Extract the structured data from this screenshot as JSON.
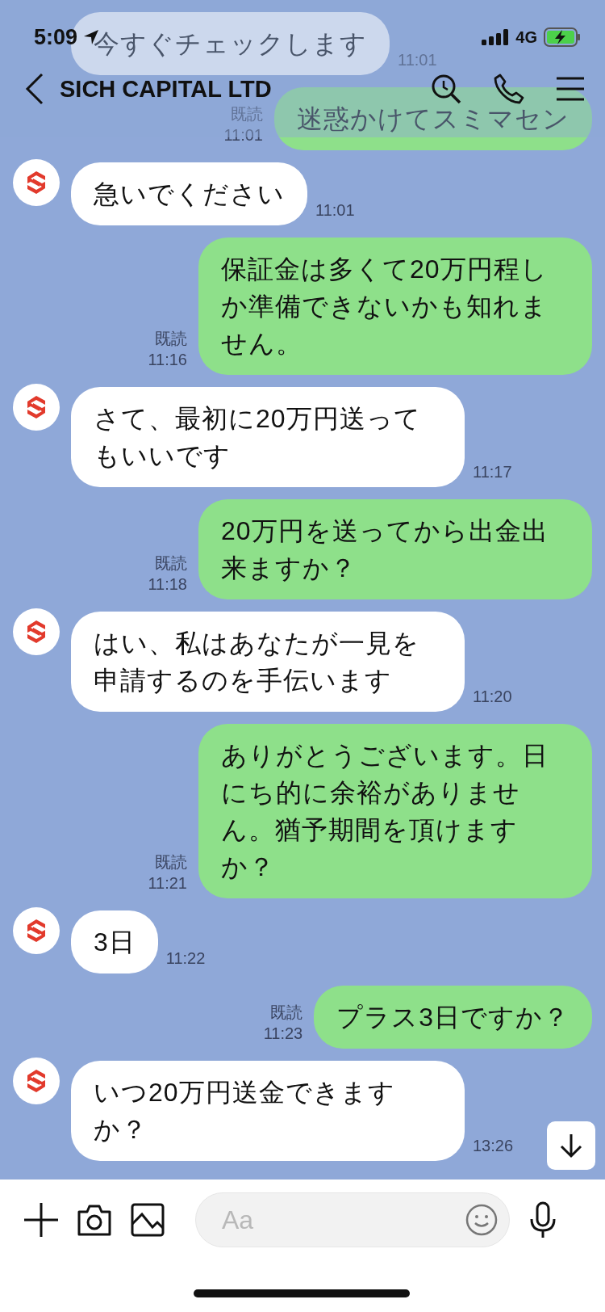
{
  "status_bar": {
    "time": "5:09",
    "network": "4G"
  },
  "header": {
    "title": "SICH CAPITAL LTD"
  },
  "messages": [
    {
      "kind": "incoming",
      "avatar": false,
      "text": "今すぐチェックします",
      "time": "11:01"
    },
    {
      "kind": "outgoing",
      "read_label": "既読",
      "text": "迷惑かけてスミマセン",
      "time": "11:01"
    },
    {
      "kind": "incoming",
      "avatar": true,
      "text": "急いでください",
      "time": "11:01"
    },
    {
      "kind": "outgoing",
      "read_label": "既読",
      "text": "保証金は多くて20万円程しか準備できないかも知れません。",
      "time": "11:16"
    },
    {
      "kind": "incoming",
      "avatar": true,
      "text": "さて、最初に20万円送ってもいいです",
      "time": "11:17"
    },
    {
      "kind": "outgoing",
      "read_label": "既読",
      "text": "20万円を送ってから出金出来ますか？",
      "time": "11:18"
    },
    {
      "kind": "incoming",
      "avatar": true,
      "text": "はい、私はあなたが一見を申請するのを手伝います",
      "time": "11:20"
    },
    {
      "kind": "outgoing",
      "read_label": "既読",
      "text": "ありがとうございます。日にち的に余裕がありません。猶予期間を頂けますか？",
      "time": "11:21"
    },
    {
      "kind": "incoming",
      "avatar": true,
      "text": "3日",
      "time": "11:22"
    },
    {
      "kind": "outgoing",
      "read_label": "既読",
      "text": "プラス3日ですか？",
      "time": "11:23"
    },
    {
      "kind": "incoming",
      "avatar": true,
      "text": "いつ20万円送金できますか？",
      "time": "13:26"
    }
  ],
  "input_bar": {
    "placeholder": "Aa"
  }
}
